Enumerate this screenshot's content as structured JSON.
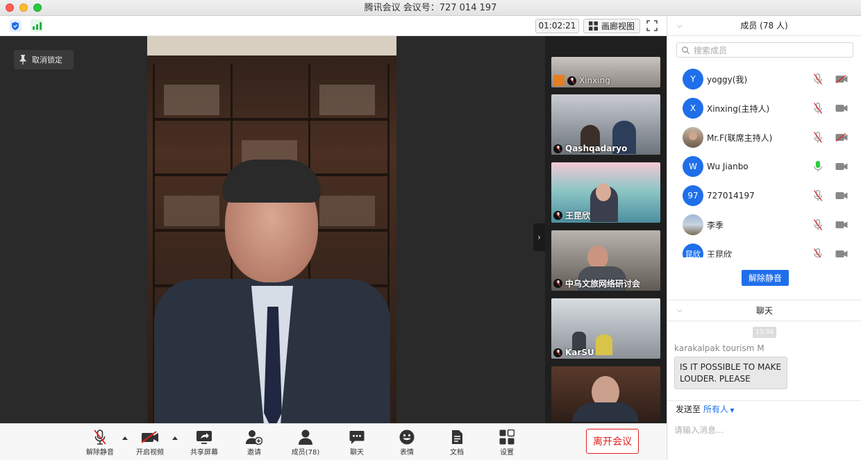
{
  "window": {
    "title": "腾讯会议 会议号：727 014 197"
  },
  "toolbar": {
    "timer": "01:02:21",
    "view_label": "画廊视图"
  },
  "stage": {
    "unlock_label": "取消锁定"
  },
  "thumbnails": [
    {
      "name": "Xinxing"
    },
    {
      "name": "Qashqadaryo"
    },
    {
      "name": "王昆欣"
    },
    {
      "name": "中乌文旅网络研讨会"
    },
    {
      "name": "KarSU"
    },
    {
      "name": ""
    }
  ],
  "bottom": {
    "unmute": "解除静音",
    "start_video": "开启视频",
    "share": "共享屏幕",
    "invite": "邀请",
    "members": "成员(78)",
    "chat": "聊天",
    "reactions": "表情",
    "docs": "文档",
    "settings": "设置",
    "leave": "离开会议"
  },
  "panel": {
    "members_title": "成员 (78 人)",
    "search_placeholder": "搜索成员",
    "members": [
      {
        "initial": "Y",
        "name": "yoggy(我)",
        "mic": "muted",
        "cam": "off"
      },
      {
        "initial": "X",
        "name": "Xinxing(主持人)",
        "mic": "muted",
        "cam": "on"
      },
      {
        "initial": "",
        "name": "Mr.F(联席主持人)",
        "mic": "muted",
        "cam": "off",
        "photo": true
      },
      {
        "initial": "W",
        "name": "Wu Jianbo",
        "mic": "speaking",
        "cam": "on"
      },
      {
        "initial": "97",
        "name": "727014197",
        "mic": "muted",
        "cam": "on"
      },
      {
        "initial": "",
        "name": "李季",
        "mic": "muted",
        "cam": "on",
        "photo": true
      },
      {
        "initial": "昆欣",
        "name": "王昆欣",
        "mic": "muted",
        "cam": "on"
      }
    ],
    "unmute_all": "解除静音",
    "chat_title": "聊天",
    "chat": {
      "time": "13:34",
      "sender": "karakalpak tourism M",
      "message_line1": "IS IT POSSIBLE TO MAKE",
      "message_line2": "LOUDER. PLEASE"
    },
    "send_to_label": "发送至",
    "send_to_target": "所有人",
    "input_placeholder": "请输入消息..."
  },
  "colors": {
    "accent": "#1f6fea",
    "danger": "#e02020",
    "speaking": "#2ecc40"
  }
}
